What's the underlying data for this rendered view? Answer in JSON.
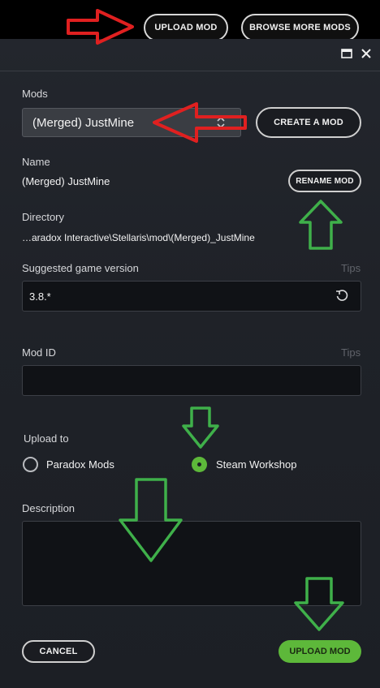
{
  "topbar": {
    "upload_label": "UPLOAD MOD",
    "browse_label": "BROWSE MORE MODS"
  },
  "window": {
    "maximize_icon": "maximize-icon",
    "close_icon": "close-icon"
  },
  "mods": {
    "label": "Mods",
    "selected": "(Merged) JustMine",
    "create_label": "CREATE A MOD"
  },
  "name": {
    "label": "Name",
    "value": "(Merged) JustMine",
    "rename_label": "RENAME MOD"
  },
  "directory": {
    "label": "Directory",
    "value": "…aradox Interactive\\Stellaris\\mod\\(Merged)_JustMine"
  },
  "game_version": {
    "label": "Suggested game version",
    "tips": "Tips",
    "value": "3.8.*"
  },
  "mod_id": {
    "label": "Mod ID",
    "tips": "Tips",
    "value": ""
  },
  "upload_to": {
    "label": "Upload to",
    "options": [
      "Paradox Mods",
      "Steam Workshop"
    ],
    "selected": "Steam Workshop"
  },
  "description": {
    "label": "Description",
    "value": ""
  },
  "footer": {
    "cancel_label": "CANCEL",
    "upload_label": "UPLOAD MOD"
  },
  "colors": {
    "accent_green": "#5db83a",
    "annotation_red": "#e02020",
    "annotation_green": "#3fb04a"
  }
}
